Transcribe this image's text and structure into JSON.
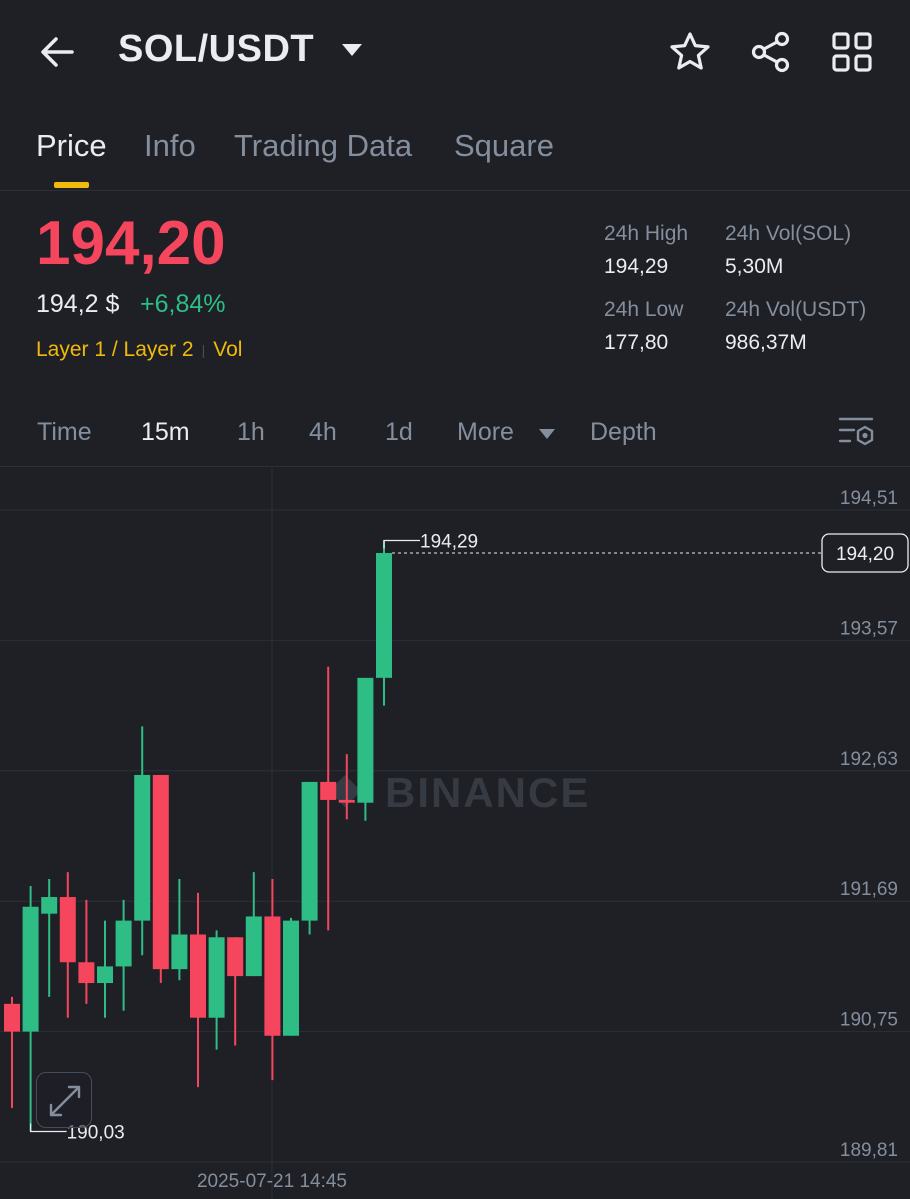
{
  "header": {
    "pair": "SOL/USDT",
    "icons": [
      "back-arrow-icon",
      "caret-down-icon",
      "star-icon",
      "share-icon",
      "grid-icon"
    ]
  },
  "tabs": [
    {
      "label": "Price",
      "active": true
    },
    {
      "label": "Info"
    },
    {
      "label": "Trading Data"
    },
    {
      "label": "Square"
    }
  ],
  "price": {
    "last": "194,20",
    "usd": "194,2 $",
    "change": "+6,84%",
    "tag1": "Layer 1 / Layer 2",
    "tag2": "Vol"
  },
  "stats": {
    "high_label": "24h High",
    "high": "194,29",
    "low_label": "24h Low",
    "low": "177,80",
    "vol_base_label": "24h Vol(SOL)",
    "vol_base": "5,30M",
    "vol_quote_label": "24h Vol(USDT)",
    "vol_quote": "986,37M"
  },
  "intervals": [
    "Time",
    "15m",
    "1h",
    "4h",
    "1d",
    "More",
    "Depth"
  ],
  "active_interval": "15m",
  "colors": {
    "up": "#2ebd85",
    "down": "#f6465d",
    "accent": "#f0b90b",
    "bg": "#1e2026",
    "grid": "#2b2f36"
  },
  "chart_data": {
    "type": "candlestick",
    "watermark": "BINANCE",
    "y_ticks": [
      "194,51",
      "193,57",
      "192,63",
      "191,69",
      "190,75",
      "189,81"
    ],
    "y_tick_values": [
      194.51,
      193.57,
      192.63,
      191.69,
      190.75,
      189.81
    ],
    "ylim": [
      189.81,
      194.51
    ],
    "x_label": "2025-07-21 14:45",
    "last_price_label": "194,20",
    "last_price": 194.2,
    "high_marker": "194,29",
    "low_marker": "190,03",
    "candles": [
      {
        "o": 190.95,
        "h": 191.0,
        "l": 190.2,
        "c": 190.75
      },
      {
        "o": 190.75,
        "h": 191.8,
        "l": 190.03,
        "c": 191.65
      },
      {
        "o": 191.6,
        "h": 191.85,
        "l": 191.0,
        "c": 191.72
      },
      {
        "o": 191.72,
        "h": 191.9,
        "l": 190.85,
        "c": 191.25
      },
      {
        "o": 191.25,
        "h": 191.7,
        "l": 190.95,
        "c": 191.1
      },
      {
        "o": 191.1,
        "h": 191.55,
        "l": 190.85,
        "c": 191.22
      },
      {
        "o": 191.22,
        "h": 191.7,
        "l": 190.9,
        "c": 191.55
      },
      {
        "o": 191.55,
        "h": 192.95,
        "l": 191.3,
        "c": 192.6
      },
      {
        "o": 192.6,
        "h": 192.6,
        "l": 191.1,
        "c": 191.2
      },
      {
        "o": 191.2,
        "h": 191.85,
        "l": 191.12,
        "c": 191.45
      },
      {
        "o": 191.45,
        "h": 191.75,
        "l": 190.35,
        "c": 190.85
      },
      {
        "o": 190.85,
        "h": 191.48,
        "l": 190.62,
        "c": 191.43
      },
      {
        "o": 191.43,
        "h": 191.43,
        "l": 190.65,
        "c": 191.15
      },
      {
        "o": 191.15,
        "h": 191.9,
        "l": 191.15,
        "c": 191.58
      },
      {
        "o": 191.58,
        "h": 191.85,
        "l": 190.4,
        "c": 190.72
      },
      {
        "o": 190.72,
        "h": 191.57,
        "l": 190.72,
        "c": 191.55
      },
      {
        "o": 191.55,
        "h": 192.43,
        "l": 191.45,
        "c": 192.55
      },
      {
        "o": 192.55,
        "h": 193.38,
        "l": 191.48,
        "c": 192.42
      },
      {
        "o": 192.42,
        "h": 192.75,
        "l": 192.28,
        "c": 192.4
      },
      {
        "o": 192.4,
        "h": 193.05,
        "l": 192.27,
        "c": 193.3
      },
      {
        "o": 193.3,
        "h": 194.29,
        "l": 193.1,
        "c": 194.2
      }
    ]
  }
}
